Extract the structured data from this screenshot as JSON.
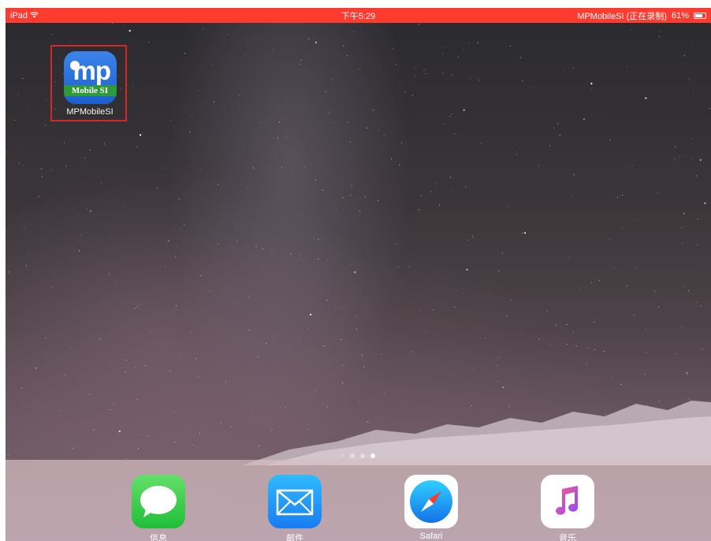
{
  "status_bar": {
    "device": "iPad",
    "time": "下午5:29",
    "recording": "MPMobileSI (正在录制)",
    "battery": "61%",
    "color": "#ff3b30"
  },
  "home_screen": {
    "apps": [
      {
        "label": "MPMobileSI",
        "icon": "mpmobilesi-app-icon",
        "icon_text": "mp",
        "icon_subtext": "Mobile SI"
      }
    ]
  },
  "page_indicator": {
    "pages": 3,
    "current": 3
  },
  "dock": {
    "apps": [
      {
        "label": "信息",
        "icon": "messages-icon"
      },
      {
        "label": "邮件",
        "icon": "mail-icon"
      },
      {
        "label": "Safari",
        "icon": "safari-icon"
      },
      {
        "label": "音乐",
        "icon": "music-icon"
      }
    ]
  }
}
